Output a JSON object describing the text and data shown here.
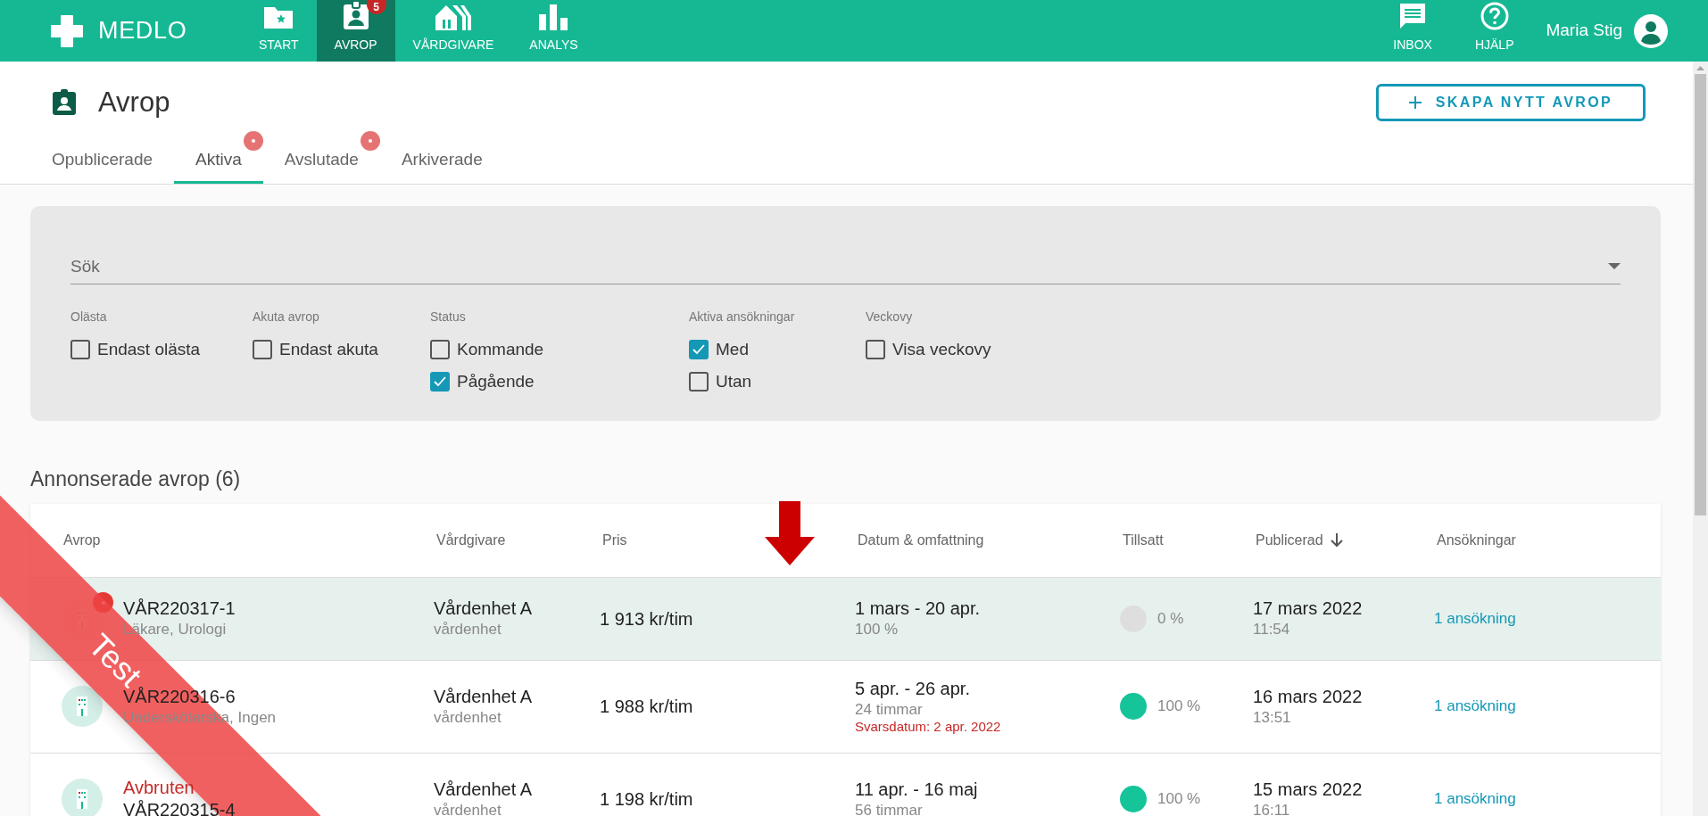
{
  "app": {
    "name": "MEDLO",
    "user": "Maria Stig"
  },
  "nav": [
    {
      "label": "START",
      "selected": false
    },
    {
      "label": "AVROP",
      "selected": true,
      "badge": "5"
    },
    {
      "label": "VÅRDGIVARE",
      "selected": false
    },
    {
      "label": "ANALYS",
      "selected": false
    }
  ],
  "nav_right": [
    {
      "label": "INBOX"
    },
    {
      "label": "HJÄLP"
    }
  ],
  "page": {
    "title": "Avrop",
    "create_button": "SKAPA NYTT AVROP"
  },
  "tabs": [
    {
      "label": "Opublicerade",
      "selected": false,
      "dot": false
    },
    {
      "label": "Aktiva",
      "selected": true,
      "dot": true
    },
    {
      "label": "Avslutade",
      "selected": false,
      "dot": true
    },
    {
      "label": "Arkiverade",
      "selected": false,
      "dot": false
    }
  ],
  "search": {
    "placeholder": "Sök"
  },
  "filters": [
    {
      "label": "Olästa",
      "options": [
        {
          "label": "Endast olästa",
          "checked": false
        }
      ]
    },
    {
      "label": "Akuta avrop",
      "options": [
        {
          "label": "Endast akuta",
          "checked": false
        }
      ]
    },
    {
      "label": "Status",
      "options": [
        {
          "label": "Kommande",
          "checked": false
        },
        {
          "label": "Pågående",
          "checked": true
        }
      ]
    },
    {
      "label": "Aktiva ansökningar",
      "options": [
        {
          "label": "Med",
          "checked": true
        },
        {
          "label": "Utan",
          "checked": false
        }
      ]
    },
    {
      "label": "Veckovy",
      "options": [
        {
          "label": "Visa veckovy",
          "checked": false
        }
      ]
    }
  ],
  "section_title": "Annonserade avrop (6)",
  "table": {
    "columns": [
      {
        "label": "Avrop",
        "sorted": false
      },
      {
        "label": "Vårdgivare",
        "sorted": false
      },
      {
        "label": "Pris",
        "sorted": false
      },
      {
        "label": "Datum & omfattning",
        "sorted": false
      },
      {
        "label": "Tillsatt",
        "sorted": false
      },
      {
        "label": "Publicerad",
        "sorted": true
      },
      {
        "label": "Ansökningar",
        "sorted": false
      }
    ],
    "rows": [
      {
        "selected": true,
        "unread": true,
        "status": null,
        "id": "VÅR220317-1",
        "role": "Läkare, Urologi",
        "provider": "Vårdenhet A",
        "provider_type": "vårdenhet",
        "price": "1 913 kr/tim",
        "dates": "1 mars - 20 apr.",
        "scope": "100 %",
        "deadline": null,
        "filled": {
          "complete": false,
          "reading": "0 %"
        },
        "published": "17 mars 2022",
        "time": "11:54",
        "applications": "1 ansökning"
      },
      {
        "selected": false,
        "unread": false,
        "status": null,
        "id": "VÅR220316-6",
        "role": "Undersköterska, Ingen",
        "provider": "Vårdenhet A",
        "provider_type": "vårdenhet",
        "price": "1 988 kr/tim",
        "dates": "5 apr. - 26 apr.",
        "scope": "24 timmar",
        "deadline": "Svarsdatum: 2 apr. 2022",
        "filled": {
          "complete": true,
          "reading": "100 %"
        },
        "published": "16 mars 2022",
        "time": "13:51",
        "applications": "1 ansökning"
      },
      {
        "selected": false,
        "unread": false,
        "status": "Avbruten",
        "id": "VÅR220315-4",
        "role": null,
        "provider": "Vårdenhet A",
        "provider_type": "vårdenhet",
        "price": "1 198 kr/tim",
        "dates": "11 apr. - 16 maj",
        "scope": "56 timmar",
        "deadline": null,
        "filled": {
          "complete": true,
          "reading": "100 %"
        },
        "published": "15 mars 2022",
        "time": "16:11",
        "applications": "1 ansökning"
      }
    ]
  },
  "environment_ribbon": "Test"
}
